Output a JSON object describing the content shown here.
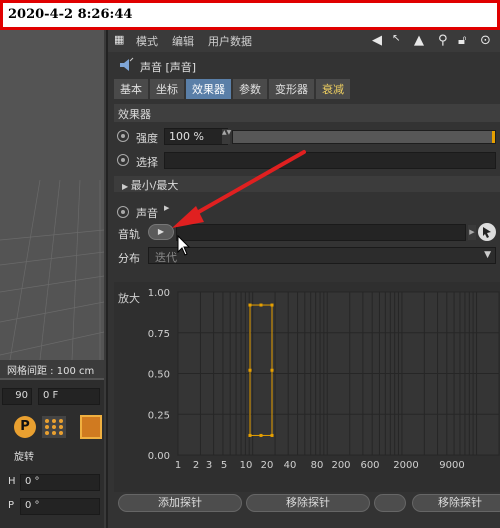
{
  "timestamp": "2020-4-2 8:26:44",
  "menu": {
    "items": [
      "模式",
      "编辑",
      "用户数据"
    ]
  },
  "object": {
    "title": "声音 [声音]"
  },
  "tabs": [
    {
      "label": "基本"
    },
    {
      "label": "坐标"
    },
    {
      "label": "效果器"
    },
    {
      "label": "参数"
    },
    {
      "label": "变形器"
    },
    {
      "label": "衰减"
    }
  ],
  "active_tab": "效果器",
  "effector_section": {
    "title": "效果器"
  },
  "strength": {
    "label": "强度",
    "value": "100 %"
  },
  "selection": {
    "label": "选择"
  },
  "minmax": {
    "label": "最小/最大"
  },
  "sound": {
    "label": "声音"
  },
  "track": {
    "label": "音轨"
  },
  "distribution": {
    "label": "分布",
    "value": "迭代"
  },
  "graph": {
    "ylabel": "放大",
    "yticks": [
      "1.00",
      "0.75",
      "0.50",
      "0.25",
      "0.00"
    ],
    "xticks": [
      "1",
      "2",
      "3",
      "5",
      "10",
      "20",
      "40",
      "80",
      "200",
      "600",
      "2000",
      "9000"
    ]
  },
  "chart_data": {
    "type": "area",
    "ylabel": "放大",
    "ylim": [
      0,
      1
    ],
    "x_scale": "log",
    "x_tick_labels": [
      "1",
      "2",
      "3",
      "5",
      "10",
      "20",
      "40",
      "80",
      "200",
      "600",
      "2000",
      "9000"
    ],
    "probe": {
      "x_start": 10,
      "x_end": 20,
      "y_bottom": 0.12,
      "y_top": 0.92
    }
  },
  "buttons": {
    "add_probe": "添加探针",
    "remove_probe": "移除探针",
    "remove_probe_2": "移除探针"
  },
  "viewport": {
    "grid_spacing": "网格间距 : 100 cm"
  },
  "left_panel": {
    "frame_value": "90",
    "frame_field": "0 F",
    "rotate_label": "旋转",
    "h_label": "H",
    "h_value": "0 °",
    "p_label": "P",
    "p_value": "0 °",
    "p_icon": "P"
  },
  "colors": {
    "accent": "#e6a000",
    "active_tab": "#5a7fa8",
    "arrow": "#e02020"
  }
}
